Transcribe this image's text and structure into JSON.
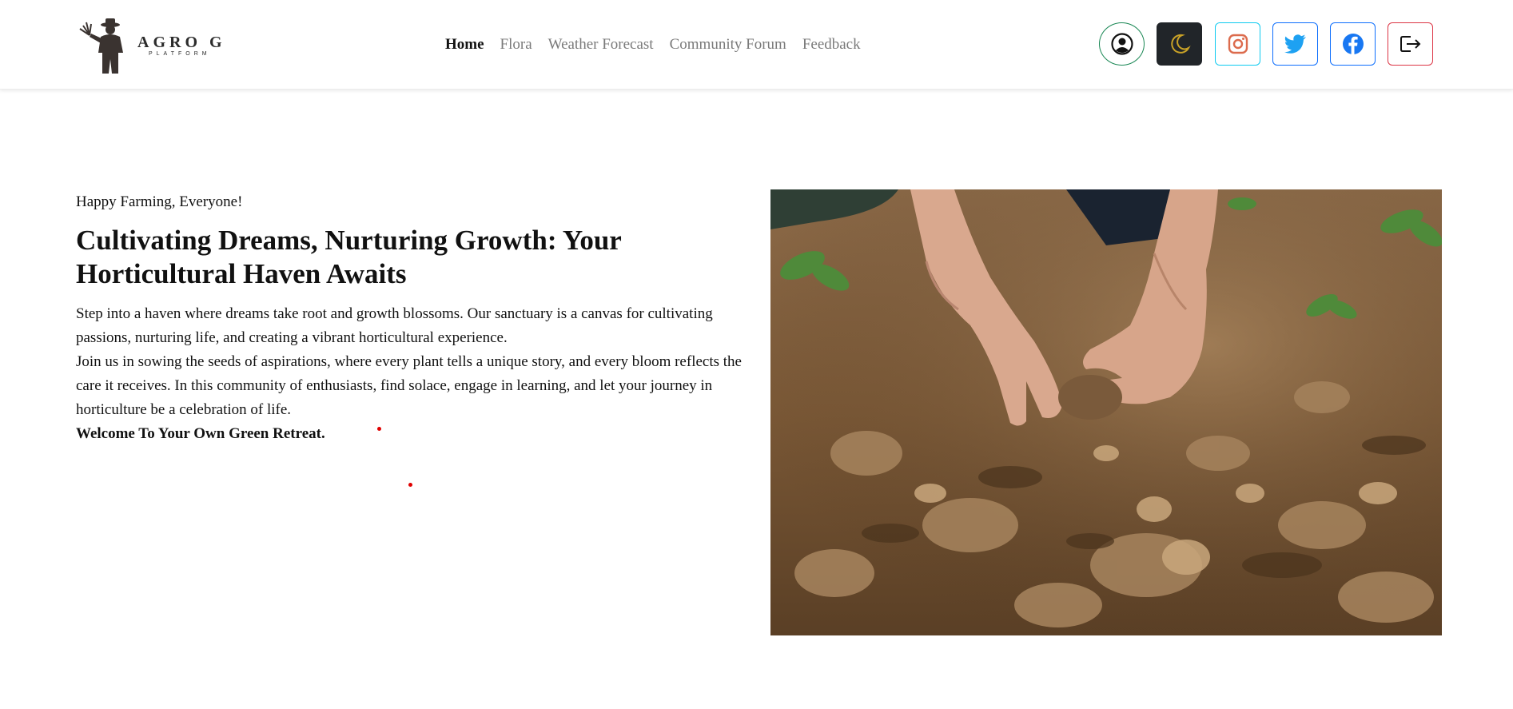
{
  "brand": {
    "name": "AGRO G",
    "sub": "PLATFORM"
  },
  "nav": {
    "items": [
      {
        "label": "Home",
        "active": true
      },
      {
        "label": "Flora",
        "active": false
      },
      {
        "label": "Weather Forecast",
        "active": false
      },
      {
        "label": "Community Forum",
        "active": false
      },
      {
        "label": "Feedback",
        "active": false
      }
    ]
  },
  "actions": {
    "icons": [
      "user-circle-icon",
      "moon-icon",
      "instagram-icon",
      "twitter-icon",
      "facebook-icon",
      "logout-icon"
    ]
  },
  "hero": {
    "greeting": "Happy Farming, Everyone!",
    "headline": "Cultivating Dreams, Nurturing Growth: Your Horticultural Haven Awaits",
    "paragraph1": "Step into a haven where dreams take root and growth blossoms. Our sanctuary is a canvas for cultivating passions, nurturing life, and creating a vibrant horticultural experience.",
    "paragraph2": "Join us in sowing the seeds of aspirations, where every plant tells a unique story, and every bloom reflects the care it receives. In this community of enthusiasts, find solace, engage in learning, and let your journey in horticulture be a celebration of life.",
    "welcome": "Welcome To Your Own Green Retreat."
  },
  "colors": {
    "moon": "#c9a227",
    "instagram": "#dc6b4d",
    "twitter": "#1da1f2",
    "facebook": "#1877f2",
    "profile_border": "#198754",
    "logout_border": "#dc3545"
  }
}
